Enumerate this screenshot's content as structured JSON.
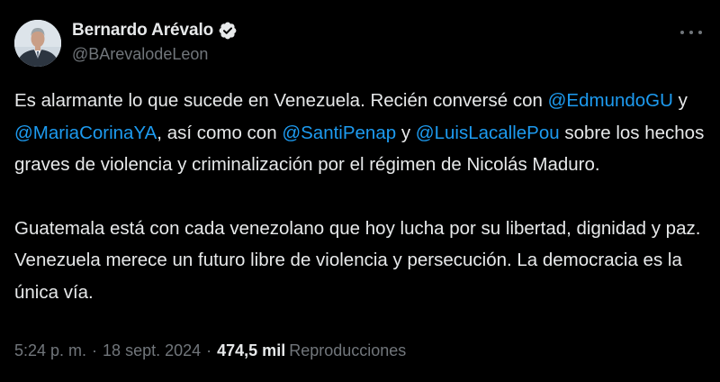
{
  "author": {
    "display_name": "Bernardo Arévalo",
    "handle": "@BArevalodeLeon",
    "verified": true,
    "avatar_icon": "profile-photo"
  },
  "tweet": {
    "paragraphs": [
      [
        {
          "type": "text",
          "value": "Es alarmante lo que sucede en Venezuela. Recién conversé con "
        },
        {
          "type": "mention",
          "value": "@EdmundoGU"
        },
        {
          "type": "text",
          "value": " y "
        },
        {
          "type": "mention",
          "value": "@MariaCorinaYA"
        },
        {
          "type": "text",
          "value": ", así como con "
        },
        {
          "type": "mention",
          "value": "@SantiPenap"
        },
        {
          "type": "text",
          "value": " y "
        },
        {
          "type": "mention",
          "value": "@LuisLacallePou"
        },
        {
          "type": "text",
          "value": " sobre los hechos graves de violencia y criminalización por el régimen de Nicolás Maduro."
        }
      ],
      [
        {
          "type": "text",
          "value": "Guatemala está con cada venezolano que hoy lucha por su libertad, dignidad y paz. Venezuela merece un futuro libre de violencia y persecución. La democracia es la única vía."
        }
      ]
    ]
  },
  "meta": {
    "time": "5:24 p. m.",
    "separator": "·",
    "date": "18 sept. 2024",
    "views_count": "474,5 mil",
    "views_label": "Reproducciones"
  },
  "colors": {
    "background": "#000000",
    "text": "#e7e9ea",
    "secondary": "#71767b",
    "link": "#1d9bf0",
    "verified_badge": "#ffffff"
  },
  "icons": {
    "verified": "verified-badge-icon",
    "more": "more-options-icon"
  }
}
